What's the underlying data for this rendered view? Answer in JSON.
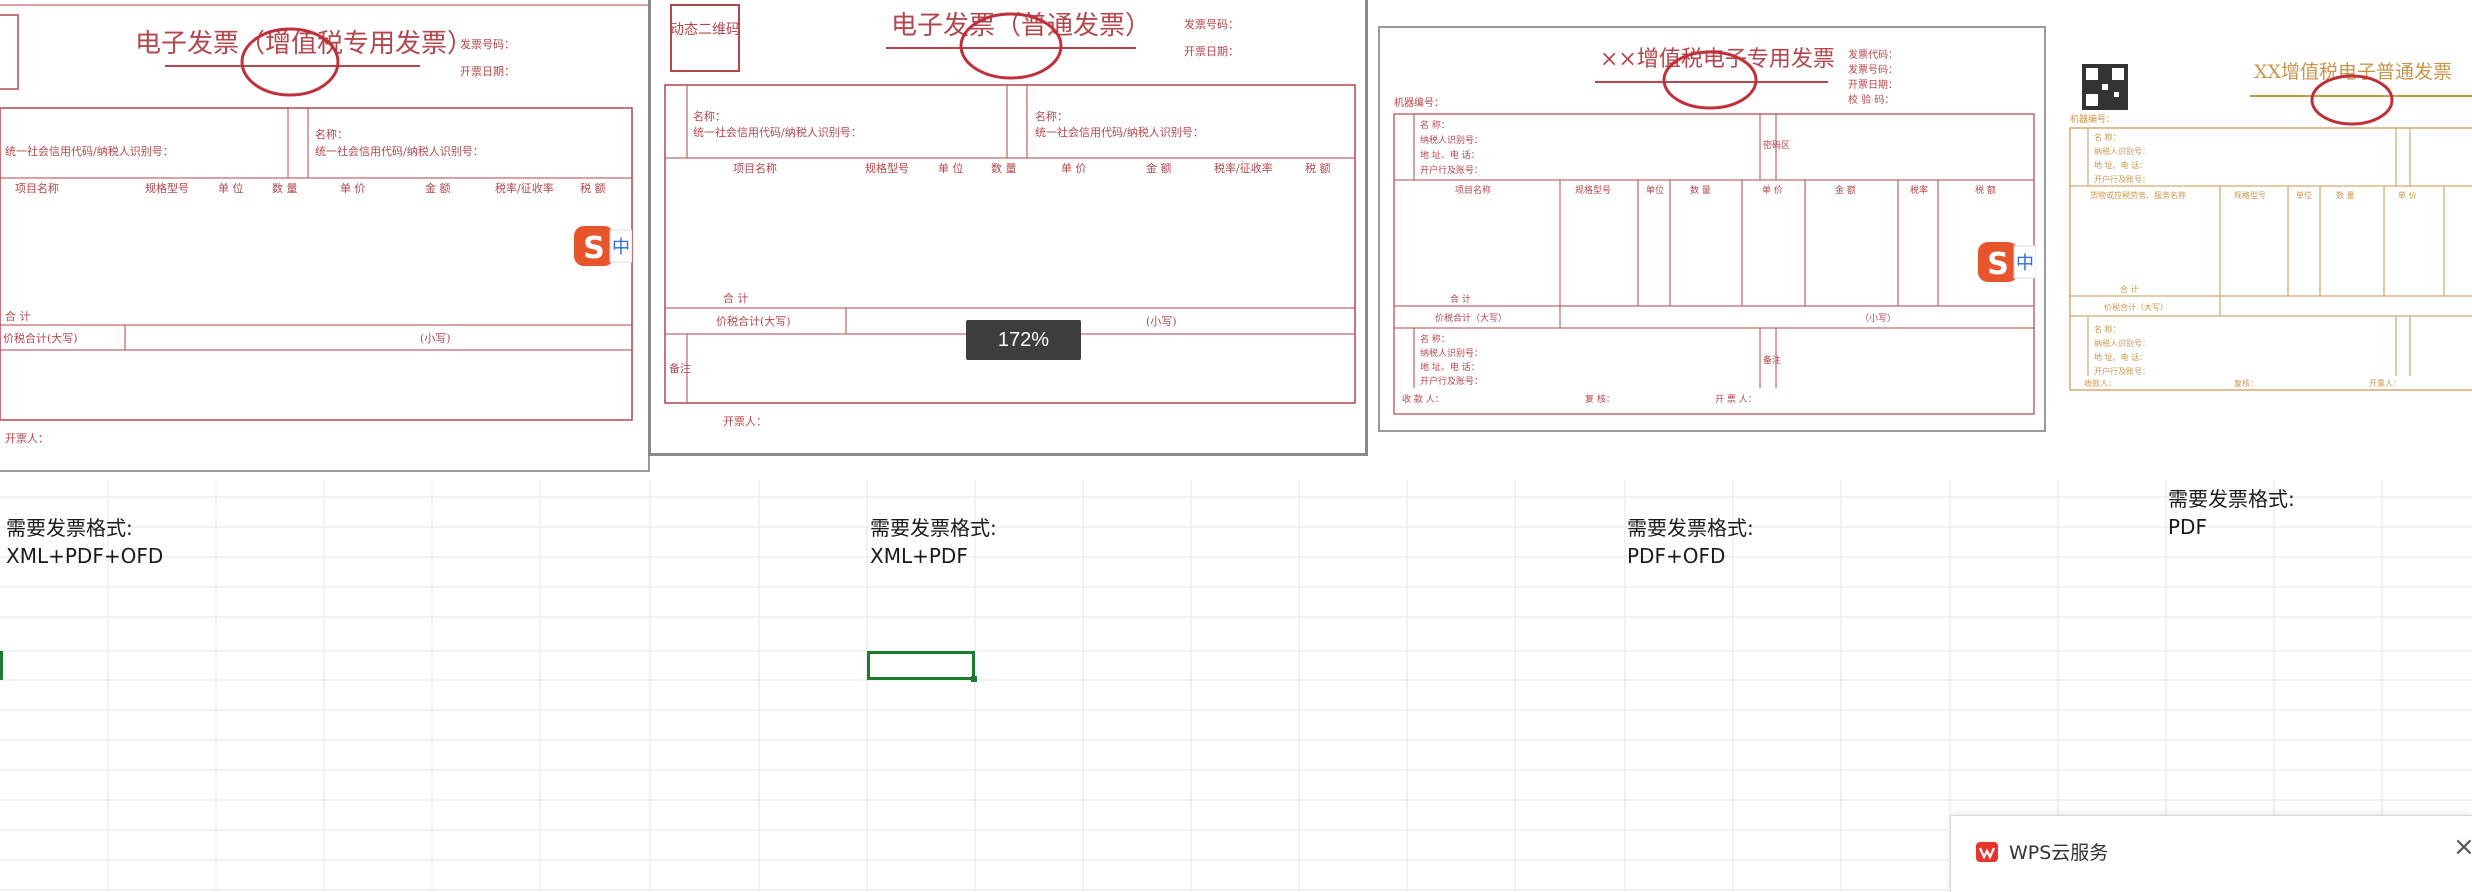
{
  "zoom_level": "172%",
  "invoices": [
    {
      "title": "电子发票（增值税专用发票）",
      "labels": [
        "发票号码：",
        "开票日期：",
        "名称：",
        "统一社会信用代码/纳税人识别号：",
        "项目名称",
        "规格型号",
        "单 位",
        "数 量",
        "单 价",
        "金 额",
        "税率/征收率",
        "税 额",
        "合 计",
        "价税合计(大写)",
        "(小写)",
        "开票人："
      ]
    },
    {
      "title": "电子发票（普通发票）",
      "qr_label": "动态二维码",
      "labels": [
        "发票号码：",
        "开票日期：",
        "名称：",
        "统一社会信用代码/纳税人识别号：",
        "项目名称",
        "规格型号",
        "单 位",
        "数 量",
        "单 价",
        "金 额",
        "税率/征收率",
        "税 额",
        "合 计",
        "价税合计(大写)",
        "(小写)",
        "备注",
        "开票人："
      ]
    },
    {
      "title": "××增值税电子专用发票",
      "labels": [
        "发票代码：",
        "发票号码：",
        "开票日期：",
        "校 验 码：",
        "机器编号：",
        "名 称：",
        "纳税人识别号：",
        "地 址、电 话：",
        "开户行及账号：",
        "密码区",
        "项目名称",
        "规格型号",
        "单位",
        "数 量",
        "单 价",
        "金 额",
        "税率",
        "税 额",
        "合 计",
        "价税合计（大写）",
        "（小写）",
        "备注",
        "收 款 人：",
        "复 核：",
        "开 票 人："
      ]
    },
    {
      "title": "XX增值税电子普通发票",
      "labels": [
        "机器编号：",
        "名 称：",
        "纳税人识别号：",
        "地 址、电 话：",
        "开户行及账号：",
        "货物或应税劳务、服务名称",
        "规格型号",
        "单位",
        "数 量",
        "单 价",
        "合 计",
        "价税合计（大写）",
        "收款人：",
        "复核：",
        "开票人："
      ]
    }
  ],
  "cells": [
    {
      "line1": "需要发票格式:",
      "line2": "XML+PDF+OFD"
    },
    {
      "line1": "需要发票格式:",
      "line2": "XML+PDF"
    },
    {
      "line1": "需要发票格式:",
      "line2": "PDF+OFD"
    },
    {
      "line1": "需要发票格式:",
      "line2": "PDF"
    }
  ],
  "sogou_ime_label": "中",
  "wps_panel": {
    "title": "WPS云服务",
    "close": "×"
  },
  "colors": {
    "invoice_red": "#b3474d",
    "invoice_orange": "#c8964c",
    "selection_green": "#1e7a2e",
    "gridline": "#e6e6e6"
  }
}
